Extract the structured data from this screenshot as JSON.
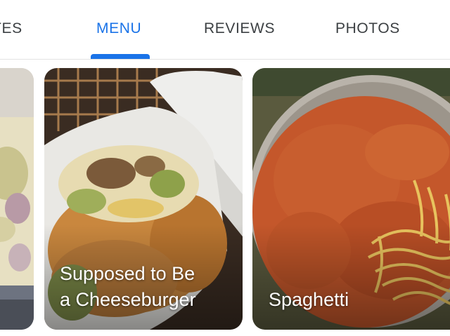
{
  "tabs": [
    {
      "label": "ATES",
      "active": false
    },
    {
      "label": "MENU",
      "active": true
    },
    {
      "label": "REVIEWS",
      "active": false
    },
    {
      "label": "PHOTOS",
      "active": false
    }
  ],
  "accent_color": "#1a73e8",
  "menu_items": [
    {
      "caption": ""
    },
    {
      "caption": "Supposed to Be\na Cheeseburger"
    },
    {
      "caption": "Spaghetti"
    }
  ]
}
